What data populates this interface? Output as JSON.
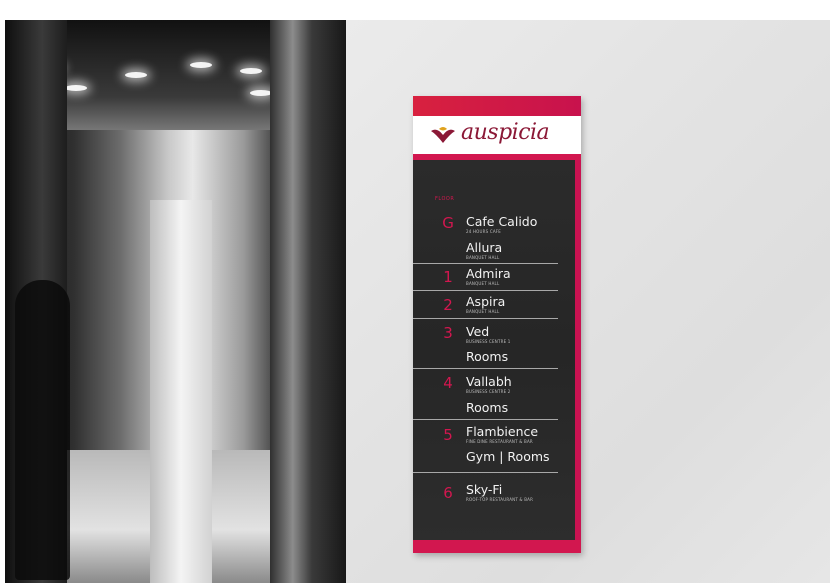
{
  "brand": {
    "name": "auspicia",
    "color_primary": "#d2174f",
    "color_logo_text": "#8b1836"
  },
  "directory": {
    "floor_heading": "FLOOR",
    "entries": [
      {
        "floor": "G",
        "name": "Cafe Calido",
        "sub": "24 HOURS CAFE"
      },
      {
        "floor": "",
        "name": "Allura",
        "sub": "BANQUET HALL"
      },
      {
        "floor": "1",
        "name": "Admira",
        "sub": "BANQUET HALL"
      },
      {
        "floor": "2",
        "name": "Aspira",
        "sub": "BANQUET HALL"
      },
      {
        "floor": "3",
        "name": "Ved",
        "sub": "BUSINESS CENTRE 1"
      },
      {
        "floor": "",
        "name": "Rooms",
        "sub": ""
      },
      {
        "floor": "4",
        "name": "Vallabh",
        "sub": "BUSINESS CENTRE 2"
      },
      {
        "floor": "",
        "name": "Rooms",
        "sub": ""
      },
      {
        "floor": "5",
        "name": "Flambience",
        "sub": "FINE DINE RESTAURANT & BAR"
      },
      {
        "floor": "",
        "name": "Gym | Rooms",
        "sub": ""
      },
      {
        "floor": "6",
        "name": "Sky-Fi",
        "sub": "ROOF-TOP RESTAURANT & BAR"
      }
    ]
  }
}
